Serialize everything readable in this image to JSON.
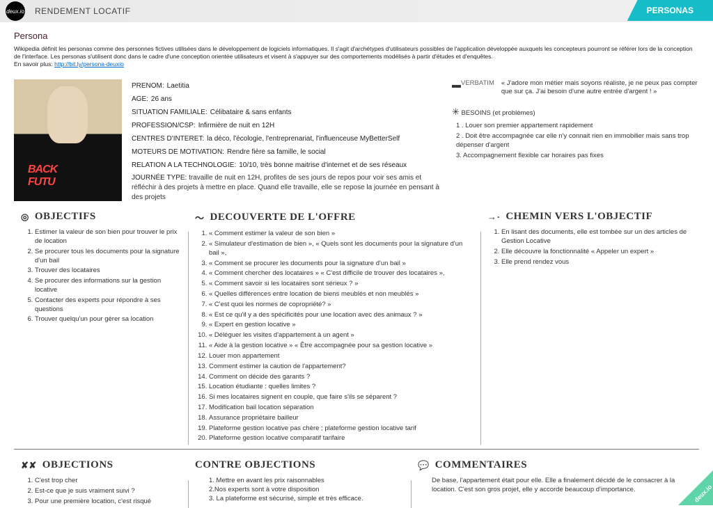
{
  "header": {
    "logo": "deux.io",
    "title": "RENDEMENT LOCATIF",
    "right": "PERSONAS"
  },
  "intro": {
    "heading": "Persona",
    "text": "Wikipedia définit les personas comme des personnes fictives utilisées dans le développement de logiciels informatiques. Il s'agit d'archétypes d'utilisateurs possibles de l'application développée auxquels les concepteurs pourront se référer lors de la conception de l'interface. Les personas s'utilisent donc dans le cadre d'une conception orientée utilisateurs et visent à s'appuyer sur des comportements modélisés à partir d'études et d'enquêtes.",
    "more_label": "En savoir plus: ",
    "more_link": "http://bit.ly/persona-deuxio"
  },
  "profile": {
    "rows": [
      {
        "label": "PRENOM:",
        "val": "Laetitia"
      },
      {
        "label": "AGE:",
        "val": "26 ans"
      },
      {
        "label": "SITUATION FAMILIALE:",
        "val": "Célibataire & sans enfants"
      },
      {
        "label": "PROFESSION/CSP:",
        "val": "Infirmière de nuit en 12H"
      },
      {
        "label": "CENTRES D'INTERET:",
        "val": "la déco, l'écologie, l'entreprenariat, l'influenceuse MyBetterSelf"
      },
      {
        "label": "MOTEURS DE MOTIVATION:",
        "val": "Rendre fière sa famille, le social"
      },
      {
        "label": "RELATION A LA TECHNOLOGIE:",
        "val": "10/10, très bonne maitrise d'internet et de ses réseaux"
      }
    ],
    "typical_label": "JOURNÉE TYPE:",
    "typical": "travaille de nuit en 12H, profites de ses jours de repos pour voir ses amis et réfléchir à des    projets à mettre en place. Quand elle travaille, elle se repose la journée en pensant à des projets"
  },
  "verbatim": {
    "label": "VERBATIM",
    "icon": "▬",
    "text": "« J'adore mon métier mais soyons réaliste, je ne peux pas compter que sur ça. J'ai besoin d'une autre entrée d'argent ! »"
  },
  "besoins": {
    "title": "BESOINS (et problèmes)",
    "icon": "✳",
    "items": [
      "1 . Louer son premier appartement rapidement",
      "2 . Doit être accompagnée car elle n'y connait rien en immobilier mais sans trop dépenser d'argent",
      "3. Accompagnement flexible car horaires pas fixes"
    ]
  },
  "objectifs": {
    "title": "OBJECTIFS",
    "icon": "◎",
    "items": [
      "Estimer la valeur de son bien pour trouver le prix de location",
      "Se procurer tous les documents pour la signature d'un bail",
      "Trouver des locataires",
      "Se procurer des informations sur la gestion locative",
      "Contacter des experts pour répondre à ses questions",
      "Trouver quelqu'un pour gérer sa location"
    ]
  },
  "decouverte": {
    "title": "DECOUVERTE DE L'OFFRE",
    "icon": "〜",
    "items": [
      "« Comment estimer la valeur de son bien »",
      "« Simulateur d'estimation de bien », « Quels sont les documents pour la signature d'un bail »,",
      "« Comment se procurer les documents pour la signature d'un bail »",
      "« Comment chercher des locataires »  « C'est difficile de trouver des locataires »,",
      "« Comment savoir si les locataires sont sérieux ? »",
      "« Quelles différences entre location de biens meublés et non meublés »",
      "« C'est quoi les normes de copropriété? »",
      "« Est ce qu'il y a des spécificités pour une location avec des animaux ? »",
      "« Expert en gestion locative »",
      "« Déléguer les visites d'appartement à un agent »",
      "« Aide à la gestion locative » « Être accompagnée pour sa gestion locative »",
      "Louer mon appartement",
      "Comment estimer la caution de l'appartement?",
      "Comment on décide des garants ?",
      "Location étudiante : quelles limites ?",
      "Si mes locataires signent en couple, que faire s'ils se séparent ?",
      "Modification bail location séparation",
      "Assurance propriétaire bailleur",
      "Plateforme gestion locative pas chère ; plateforme gestion locative tarif",
      "Plateforme gestion locative comparatif tarifaire"
    ]
  },
  "chemin": {
    "title": "CHEMIN VERS L'OBJECTIF",
    "icon": "→·",
    "items": [
      "En lisant des documents, elle est tombée sur un des articles de Gestion Locative",
      "Elle découvre la fonctionnalité « Appeler un expert »",
      "Elle prend rendez vous"
    ]
  },
  "objections": {
    "title": "OBJECTIONS",
    "icon": "✘✘",
    "items": [
      "C'est trop cher",
      "Est-ce que je suis vraiment suivi ?",
      "Pour une première location, c'est risqué"
    ]
  },
  "contre": {
    "title": "CONTRE OBJECTIONS",
    "items": [
      "1. Mettre en avant les prix raisonnables",
      "2.Nos experts sont à votre disposition",
      "3. La plateforme est sécurisé, simple et très efficace."
    ]
  },
  "commentaires": {
    "title": "COMMENTAIRES",
    "icon": "💬",
    "text": "De base, l'appartement était pour elle. Elle a finalement décidé de le consacrer à la location. C'est son gros projet, elle y accorde beaucoup d'importance."
  },
  "corner": "deux.io"
}
